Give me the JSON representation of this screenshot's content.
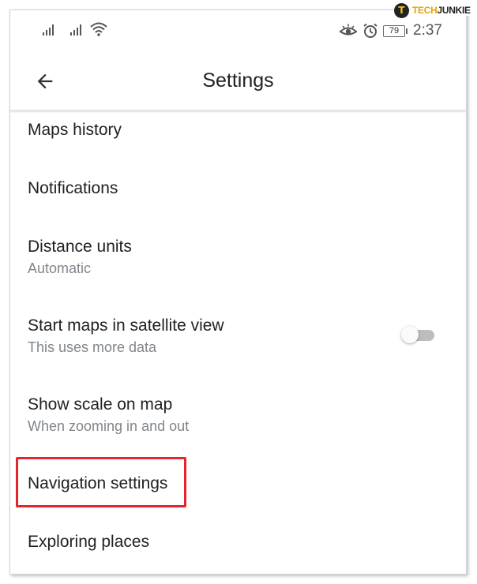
{
  "watermark": {
    "logo_letter": "T",
    "brand_part1": "TECH",
    "brand_part2": "JUNKIE"
  },
  "status_bar": {
    "icons": [
      "signal-icon",
      "signal-icon",
      "wifi-icon",
      "eye-icon",
      "alarm-icon"
    ],
    "battery_level": "79",
    "time": "2:37"
  },
  "app_bar": {
    "back_icon": "arrow-back-icon",
    "title": "Settings"
  },
  "settings": {
    "items": [
      {
        "title": "Maps history"
      },
      {
        "title": "Notifications"
      },
      {
        "title": "Distance units",
        "subtitle": "Automatic"
      },
      {
        "title": "Start maps in satellite view",
        "subtitle": "This uses more data",
        "toggle_on": false
      },
      {
        "title": "Show scale on map",
        "subtitle": "When zooming in and out"
      },
      {
        "title": "Navigation settings",
        "highlighted": true
      },
      {
        "title": "Exploring places"
      }
    ]
  },
  "colors": {
    "highlight": "#e5252a",
    "title_text": "#202124",
    "subtitle_text": "#80868b"
  }
}
